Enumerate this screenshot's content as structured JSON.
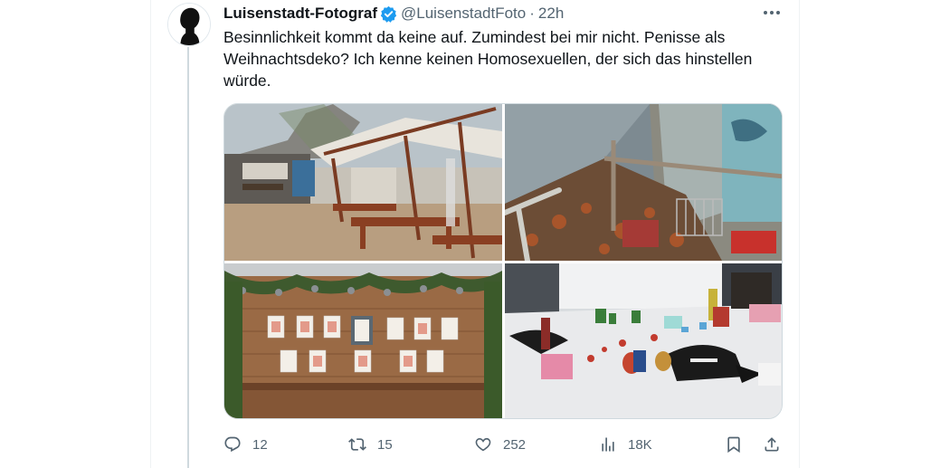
{
  "tweet": {
    "author": {
      "display_name": "Luisenstadt-Fotograf",
      "handle": "@LuisenstadtFoto",
      "verified": true
    },
    "separator": "·",
    "time": "22h",
    "more_icon": "more-horizontal-icon",
    "text": "Besinnlichkeit kommt da keine auf. Zumindest bei mir nicht. Penisse als Weihnachtsdeko? Ich kenne keinen Homosexuellen, der sich das hinstellen würde.",
    "media": [
      {
        "description_icon": "photo-beer-garden"
      },
      {
        "description_icon": "photo-riverside-debris"
      },
      {
        "description_icon": "photo-market-stall"
      },
      {
        "description_icon": "photo-table-merchandise"
      }
    ],
    "actions": {
      "reply_count": "12",
      "retweet_count": "15",
      "like_count": "252",
      "views_count": "18K"
    }
  },
  "colors": {
    "text_primary": "#0f1419",
    "text_secondary": "#536471",
    "verified_blue": "#1d9bf0",
    "border": "#cfd9de"
  }
}
